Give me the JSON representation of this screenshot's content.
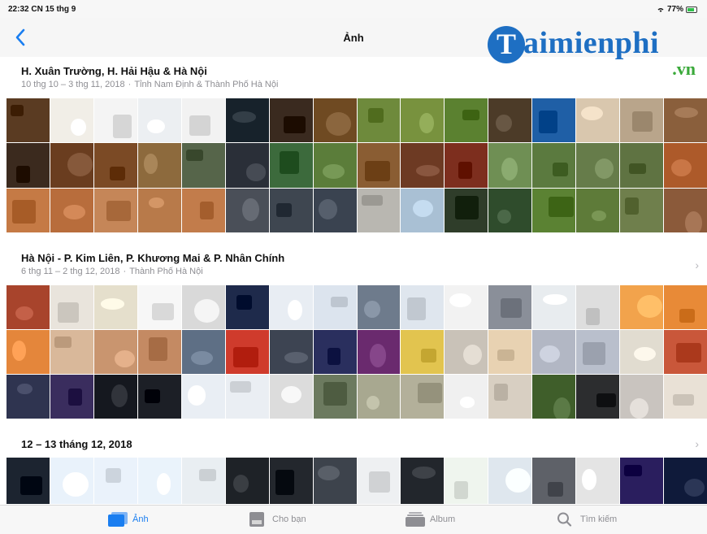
{
  "status_bar": {
    "time_date": "22:32  CN 15 thg 9",
    "battery": "77%"
  },
  "nav": {
    "title": "Ảnh"
  },
  "watermark": {
    "letter": "T",
    "text": "aimienphi",
    "domain": ".vn"
  },
  "sections": [
    {
      "title": "H. Xuân Trường, H. Hải Hậu & Hà Nội",
      "dates": "10 thg 10 – 3 thg 11, 2018",
      "location": "Tỉnh Nam Định & Thành Phố Hà Nội"
    },
    {
      "title": "Hà Nội - P. Kim Liên, P. Khương Mai & P. Nhân Chính",
      "dates": "6 thg 11 – 2 thg 12, 2018",
      "location": "Thành Phố Hà Nội"
    },
    {
      "title": "12 – 13 tháng 12, 2018",
      "dates": "",
      "location": ""
    }
  ],
  "grids": [
    {
      "rows": 3,
      "colors": [
        "#5a3b22",
        "#f1eee7",
        "#f4f4f4",
        "#eceff2",
        "#f2f2f2",
        "#17222b",
        "#3a2a1f",
        "#6f4a22",
        "#6e8a3c",
        "#78923e",
        "#5b8130",
        "#4c3b28",
        "#1f5fa6",
        "#d9c7ae",
        "#b9a58b",
        "#8a5f3c",
        "#3b2a1e",
        "#6a3d1f",
        "#7b4a25",
        "#8d6a3d",
        "#56654a",
        "#2a2f38",
        "#3c6a3c",
        "#5b7d3a",
        "#8a5d33",
        "#6d3a23",
        "#7d2e1e",
        "#6f8f54",
        "#5b7a3f",
        "#667c4a",
        "#5f7342",
        "#ad5a2a",
        "#c57a45",
        "#b86d3c",
        "#c58658",
        "#b87a4a",
        "#c27c4b",
        "#4a4f58",
        "#3e4650",
        "#3a4350",
        "#b9b7b1",
        "#a9c0d4",
        "#2f3d2a",
        "#2f4c2c",
        "#5b8233",
        "#5e7b39",
        "#6f7f4c",
        "#8b5a3a"
      ]
    },
    {
      "rows": 3,
      "colors": [
        "#a8442c",
        "#e9e4dc",
        "#e5dfcc",
        "#f7f7f7",
        "#d9d9d9",
        "#1e2a4b",
        "#e8edf3",
        "#dce4ee",
        "#6e7b8c",
        "#dfe6ee",
        "#f2f2f2",
        "#8a8f99",
        "#e8ecef",
        "#dedede",
        "#f2a34c",
        "#e88a37",
        "#e4863b",
        "#d9b89a",
        "#c9956f",
        "#c48a63",
        "#5e6f85",
        "#cf3b2c",
        "#3d4452",
        "#2a2f5e",
        "#6a2a6e",
        "#e2c44f",
        "#c9c2b8",
        "#e8d2b2",
        "#b2b7c4",
        "#b9bfcc",
        "#e1dcd0",
        "#c9573a",
        "#2f3450",
        "#3a2d5e",
        "#15181f",
        "#1c1f26",
        "#e9eef4",
        "#eaeef3",
        "#dcdcdc",
        "#6c7a5f",
        "#a8a890",
        "#b3b09a",
        "#f0f0f0",
        "#d8cfc2",
        "#3f5e2a",
        "#2c2d2f",
        "#c9c4bf",
        "#e9e1d6"
      ]
    },
    {
      "rows": 1,
      "colors": [
        "#1c2430",
        "#e9f2fb",
        "#eaf2fb",
        "#eaf3fb",
        "#e9eef2",
        "#1e2227",
        "#23272d",
        "#3d434c",
        "#eef0f2",
        "#22262c",
        "#eff5ee",
        "#dfe7ee",
        "#5e6168",
        "#e4e4e4",
        "#2a1e5e",
        "#0f1a3a"
      ]
    }
  ],
  "tab_bar": {
    "tabs": [
      {
        "label": "Ảnh",
        "icon": "photos-icon",
        "active": true
      },
      {
        "label": "Cho bạn",
        "icon": "for-you-icon",
        "active": false
      },
      {
        "label": "Album",
        "icon": "albums-icon",
        "active": false
      },
      {
        "label": "Tìm kiếm",
        "icon": "search-icon",
        "active": false
      }
    ]
  },
  "accent_color": "#1a7ef0"
}
